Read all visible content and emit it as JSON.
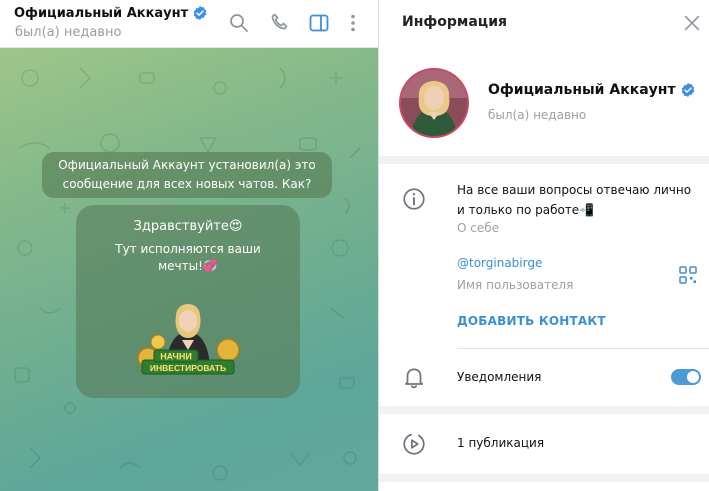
{
  "chat": {
    "title": "Официальный Аккаунт",
    "status": "был(а) недавно",
    "service_message": "Официальный Аккаунт установил(а) это сообщение для всех новых чатов. Как?",
    "greeting_title": "Здравствуйте😍",
    "greeting_text": "Тут исполняются ваши мечты!💞",
    "sticker_text_line1": "НАЧНИ",
    "sticker_text_line2": "ИНВЕСТИРОВАТЬ",
    "header_icons": [
      "search-icon",
      "phone-icon",
      "sidebar-toggle-icon",
      "more-vertical-icon"
    ]
  },
  "info": {
    "title": "Информация",
    "profile_name": "Официальный Аккаунт",
    "profile_status": "был(а) недавно",
    "bio": "На все ваши вопросы отвечаю лично и только по работе📲",
    "bio_label": "О себе",
    "username": "@torginabirge",
    "username_label": "Имя пользователя",
    "add_contact": "ДОБАВИТЬ КОНТАКТ",
    "notifications_label": "Уведомления",
    "notifications_on": true,
    "publications": "1 публикация"
  },
  "colors": {
    "accent": "#3a8fd6",
    "toggle_on": "#4a9bd8",
    "verified": "#3d8fe0",
    "muted_text": "#9aa1a9"
  }
}
